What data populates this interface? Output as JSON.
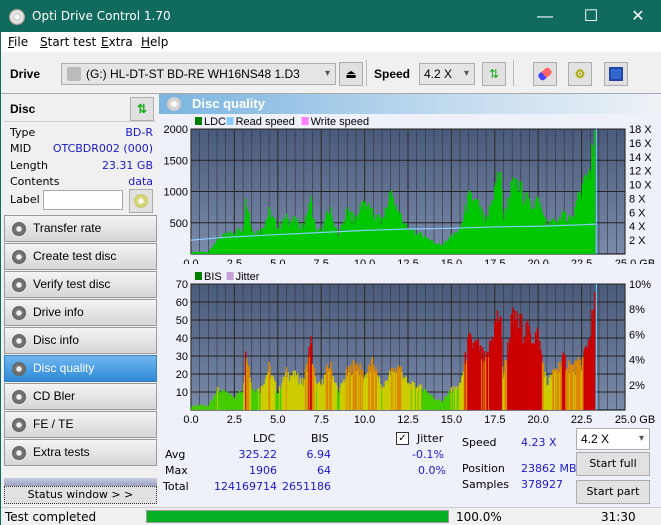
{
  "window": {
    "title": "Opti Drive Control 1.70",
    "min": "—",
    "max": "☐",
    "close": "✕"
  },
  "menu": [
    {
      "label": "File",
      "key": "F",
      "rest": "ile"
    },
    {
      "label": "Start test",
      "key": "S",
      "rest": "tart test"
    },
    {
      "label": "Extra",
      "key": "E",
      "rest": "xtra"
    },
    {
      "label": "Help",
      "key": "H",
      "rest": "elp"
    }
  ],
  "toolbar": {
    "drive_label": "Drive",
    "drive_value": "(G:)  HL-DT-ST BD-RE  WH16NS48 1.D3",
    "speed_label": "Speed",
    "speed_value": "4.2 X",
    "eject_icon": "⏏"
  },
  "disc": {
    "header": "Disc",
    "rows": [
      {
        "label": "Type",
        "value": "BD-R"
      },
      {
        "label": "MID",
        "value": "OTCBDR002 (000)"
      },
      {
        "label": "Length",
        "value": "23.31 GB"
      },
      {
        "label": "Contents",
        "value": "data"
      }
    ],
    "label_field": "Label",
    "label_value": ""
  },
  "nav": [
    {
      "label": "Transfer rate",
      "active": false
    },
    {
      "label": "Create test disc",
      "active": false
    },
    {
      "label": "Verify test disc",
      "active": false
    },
    {
      "label": "Drive info",
      "active": false
    },
    {
      "label": "Disc info",
      "active": false
    },
    {
      "label": "Disc quality",
      "active": true
    },
    {
      "label": "CD Bler",
      "active": false
    },
    {
      "label": "FE / TE",
      "active": false
    },
    {
      "label": "Extra tests",
      "active": false
    }
  ],
  "status_window_button": "Status window > >",
  "panel_title": "Disc quality",
  "stats": {
    "col_ldc": "LDC",
    "col_bis": "BIS",
    "avg_label": "Avg",
    "max_label": "Max",
    "total_label": "Total",
    "avg_ldc": "325.22",
    "avg_bis": "6.94",
    "max_ldc": "1906",
    "max_bis": "64",
    "total_ldc": "124169714",
    "total_bis": "2651186",
    "jitter_label": "Jitter",
    "jitter_checked": true,
    "jitter_avg": "-0.1%",
    "jitter_max": "0.0%",
    "speed_label": "Speed",
    "speed_value": "4.23 X",
    "position_label": "Position",
    "position_value": "23862 MB",
    "samples_label": "Samples",
    "samples_value": "378927",
    "speed_select": "4.2 X",
    "start_full": "Start full",
    "start_part": "Start part"
  },
  "statusbar": {
    "text": "Test completed",
    "progress": 100.0,
    "progress_text": "100.0%",
    "time": "31:30"
  },
  "chart_data": [
    {
      "type": "area",
      "title": "LDC",
      "legend": [
        "LDC",
        "Read speed",
        "Write speed"
      ],
      "legend_colors": [
        "#008000",
        "#88ccff",
        "#ff80ff"
      ],
      "xlabel": "GB",
      "x_ticks": [
        "0.0",
        "2.5",
        "5.0",
        "7.5",
        "10.0",
        "12.5",
        "15.0",
        "17.5",
        "20.0",
        "22.5",
        "25.0 GB"
      ],
      "xlim": [
        0,
        25
      ],
      "ylim": [
        0,
        2000
      ],
      "y_ticks": [
        "500",
        "1000",
        "1500",
        "2000"
      ],
      "y2_ticks": [
        "2 X",
        "4 X",
        "6 X",
        "8 X",
        "10 X",
        "12 X",
        "14 X",
        "16 X",
        "18 X"
      ],
      "y2lim": [
        0,
        18
      ],
      "series": [
        {
          "name": "LDC",
          "x": [
            0,
            0.5,
            1,
            1.5,
            2,
            2.5,
            3,
            3.2,
            3.5,
            4,
            4.5,
            5,
            5.5,
            6,
            6.5,
            6.9,
            7.2,
            7.5,
            8,
            8.5,
            9,
            9.5,
            10,
            10.5,
            11,
            11.5,
            12,
            12.5,
            13,
            13.5,
            14,
            14.5,
            15,
            15.5,
            16,
            16.5,
            17,
            17.5,
            17.8,
            18,
            18.5,
            19,
            19.5,
            20,
            20.5,
            21,
            21.5,
            22,
            22.5,
            23,
            23.3
          ],
          "values": [
            30,
            40,
            20,
            250,
            320,
            380,
            420,
            1000,
            400,
            380,
            700,
            450,
            600,
            550,
            450,
            900,
            350,
            400,
            750,
            300,
            700,
            600,
            900,
            650,
            550,
            1000,
            700,
            400,
            350,
            300,
            200,
            150,
            300,
            400,
            950,
            850,
            500,
            1100,
            1450,
            600,
            1150,
            1100,
            850,
            900,
            500,
            550,
            650,
            600,
            1100,
            1500,
            1906
          ]
        },
        {
          "name": "Read speed",
          "x": [
            0,
            2,
            5,
            7.5,
            10,
            12.5,
            15,
            17.5,
            20,
            22.5,
            23.3
          ],
          "values": [
            2.0,
            2.4,
            2.8,
            3.1,
            3.4,
            3.6,
            3.7,
            3.9,
            4.0,
            4.2,
            4.3
          ]
        }
      ]
    },
    {
      "type": "bar",
      "title": "BIS",
      "legend": [
        "BIS",
        "Jitter"
      ],
      "legend_colors": [
        "#008000",
        "#c8a0d8"
      ],
      "xlabel": "GB",
      "x_ticks": [
        "0.0",
        "2.5",
        "5.0",
        "7.5",
        "10.0",
        "12.5",
        "15.0",
        "17.5",
        "20.0",
        "22.5",
        "25.0 GB"
      ],
      "xlim": [
        0,
        25
      ],
      "ylim": [
        0,
        70
      ],
      "y_ticks": [
        "10",
        "20",
        "30",
        "40",
        "50",
        "60",
        "70"
      ],
      "y2_ticks": [
        "2%",
        "4%",
        "6%",
        "8%",
        "10%"
      ],
      "y2lim": [
        0,
        10
      ],
      "series": [
        {
          "name": "BIS",
          "x": [
            0,
            0.5,
            1,
            1.5,
            2,
            2.5,
            3,
            3.2,
            3.5,
            4,
            4.5,
            5,
            5.5,
            6,
            6.5,
            6.9,
            7.2,
            7.5,
            8,
            8.5,
            9,
            9.5,
            10,
            10.5,
            11,
            11.5,
            12,
            12.5,
            13,
            13.5,
            14,
            14.5,
            15,
            15.5,
            16,
            16.5,
            17,
            17.5,
            17.8,
            18,
            18.5,
            19,
            19.5,
            20,
            20.5,
            21,
            21.5,
            22,
            22.5,
            23,
            23.3
          ],
          "values": [
            2,
            3,
            2,
            12,
            10,
            8,
            12,
            38,
            13,
            12,
            25,
            10,
            22,
            20,
            16,
            40,
            14,
            15,
            27,
            10,
            22,
            28,
            20,
            28,
            12,
            22,
            26,
            15,
            14,
            12,
            7,
            5,
            12,
            14,
            40,
            38,
            28,
            50,
            58,
            20,
            53,
            50,
            45,
            44,
            15,
            24,
            30,
            25,
            28,
            45,
            64
          ]
        }
      ]
    }
  ]
}
